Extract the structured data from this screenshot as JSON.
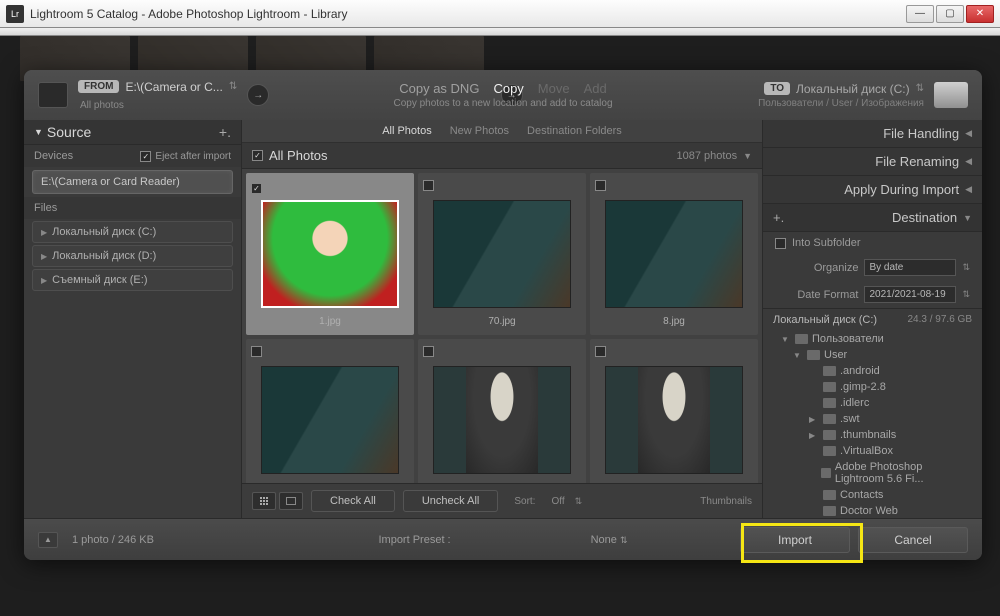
{
  "titlebar": {
    "text": "Lightroom 5 Catalog - Adobe Photoshop Lightroom - Library",
    "icon_label": "Lr"
  },
  "header": {
    "from_pill": "FROM",
    "from_path": "E:\\(Camera or C...",
    "from_sub": "All photos",
    "copy_dng": "Copy as DNG",
    "copy": "Copy",
    "move": "Move",
    "add": "Add",
    "sub": "Copy photos to a new location and add to catalog",
    "to_pill": "TO",
    "to_path": "Локальный диск (C:)",
    "to_sub": "Пользователи / User / Изображения"
  },
  "source": {
    "title": "Source",
    "devices": "Devices",
    "eject": "Eject after import",
    "device_item": "E:\\(Camera or Card Reader)",
    "files": "Files",
    "disks": [
      "Локальный диск (C:)",
      "Локальный диск (D:)",
      "Съемный диск (E:)"
    ]
  },
  "tabs": {
    "all": "All Photos",
    "new": "New Photos",
    "dest": "Destination Folders"
  },
  "grid": {
    "title": "All Photos",
    "count": "1087 photos",
    "thumbs": [
      {
        "name": "1.jpg",
        "checked": true,
        "selected": true,
        "kind": "child"
      },
      {
        "name": "70.jpg",
        "checked": false,
        "kind": "room"
      },
      {
        "name": "8.jpg",
        "checked": false,
        "kind": "room"
      },
      {
        "name": "",
        "checked": false,
        "kind": "room"
      },
      {
        "name": "",
        "checked": false,
        "kind": "portrait"
      },
      {
        "name": "",
        "checked": false,
        "kind": "portrait"
      }
    ]
  },
  "center_footer": {
    "check_all": "Check All",
    "uncheck_all": "Uncheck All",
    "sort_label": "Sort:",
    "sort_value": "Off",
    "thumb_label": "Thumbnails"
  },
  "right": {
    "file_handling": "File Handling",
    "file_renaming": "File Renaming",
    "apply_import": "Apply During Import",
    "destination": "Destination",
    "into_sub": "Into Subfolder",
    "organize_label": "Organize",
    "organize_value": "By date",
    "date_label": "Date Format",
    "date_value": "2021/2021-08-19",
    "volume": "Локальный диск (C:)",
    "volume_size": "24.3 / 97.6 GB",
    "tree": [
      {
        "label": "Пользователи",
        "depth": 1,
        "expand": "▼"
      },
      {
        "label": "User",
        "depth": 2,
        "expand": "▼"
      },
      {
        "label": ".android",
        "depth": 3,
        "expand": ""
      },
      {
        "label": ".gimp-2.8",
        "depth": 3,
        "expand": ""
      },
      {
        "label": ".idlerc",
        "depth": 3,
        "expand": ""
      },
      {
        "label": ".swt",
        "depth": 3,
        "expand": "▶"
      },
      {
        "label": ".thumbnails",
        "depth": 3,
        "expand": "▶"
      },
      {
        "label": ".VirtualBox",
        "depth": 3,
        "expand": ""
      },
      {
        "label": "Adobe Photoshop Lightroom 5.6 Fi...",
        "depth": 3,
        "expand": ""
      },
      {
        "label": "Contacts",
        "depth": 3,
        "expand": ""
      },
      {
        "label": "Doctor Web",
        "depth": 3,
        "expand": ""
      }
    ]
  },
  "footer": {
    "status": "1 photo / 246 KB",
    "preset_label": "Import Preset :",
    "preset_value": "None",
    "import": "Import",
    "cancel": "Cancel"
  }
}
